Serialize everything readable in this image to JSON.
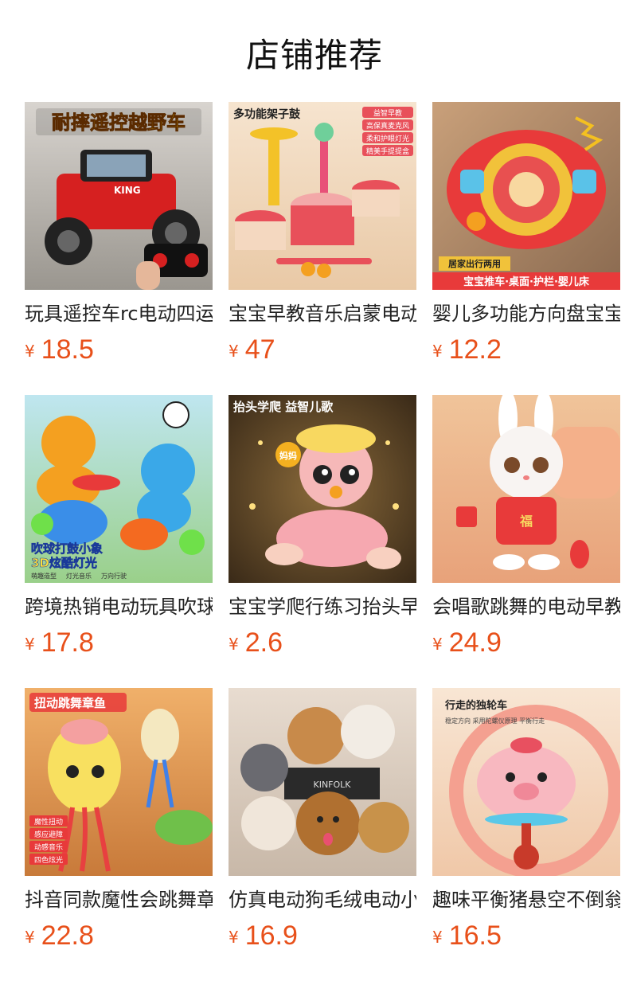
{
  "page": {
    "title": "店铺推荐"
  },
  "colors": {
    "price": "#e8501a"
  },
  "products": [
    {
      "name": "玩具遥控车rc电动四运",
      "price": "18.5",
      "currency": "¥",
      "image_label": "耐摔遥控越野车",
      "image_sub": "KING"
    },
    {
      "name": "宝宝早教音乐启蒙电动",
      "price": "47",
      "currency": "¥",
      "image_label": "多功能架子鼓",
      "image_tags": [
        "益智早教",
        "高保真麦克风",
        "柔和护眼灯光",
        "精美手提提盒"
      ]
    },
    {
      "name": "婴儿多功能方向盘宝宝",
      "price": "12.2",
      "currency": "¥",
      "image_label": "居家出行两用",
      "image_sub": "宝宝推车·桌面·护栏·婴儿床"
    },
    {
      "name": "跨境热销电动玩具吹球",
      "price": "17.8",
      "currency": "¥",
      "image_label": "吹球打鼓小象",
      "image_sub": "3D炫酷灯光",
      "image_tags": [
        "萌趣造型",
        "灯光音乐",
        "万向行驶"
      ]
    },
    {
      "name": "宝宝学爬行练习抬头早",
      "price": "2.6",
      "currency": "¥",
      "image_label": "抬头学爬 益智儿歌",
      "image_sub": "妈妈"
    },
    {
      "name": "会唱歌跳舞的电动早教",
      "price": "24.9",
      "currency": "¥",
      "image_sub": "福"
    },
    {
      "name": "抖音同款魔性会跳舞章",
      "price": "22.8",
      "currency": "¥",
      "image_label": "扭动跳舞章鱼",
      "image_tags": [
        "魔性扭动",
        "感应避障",
        "动感音乐",
        "四色炫光"
      ]
    },
    {
      "name": "仿真电动狗毛绒电动小",
      "price": "16.9",
      "currency": "¥",
      "image_sub": "KINFOLK"
    },
    {
      "name": "趣味平衡猪悬空不倒翁",
      "price": "16.5",
      "currency": "¥",
      "image_label": "行走的独轮车",
      "image_sub": "稳定方向 采用陀螺仪原理 平衡行走"
    }
  ]
}
